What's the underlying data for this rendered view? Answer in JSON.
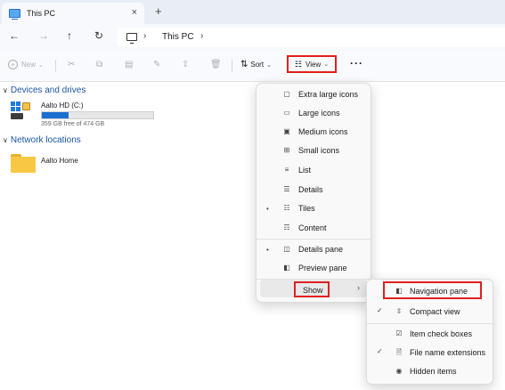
{
  "tab": {
    "title": "This PC",
    "close": "×",
    "new_tab": "+"
  },
  "nav": {
    "back": "←",
    "forward": "→",
    "up": "↑",
    "refresh": "↻"
  },
  "address": {
    "crumb": "This PC",
    "sep1": "›",
    "sep2": "›"
  },
  "toolbar": {
    "new_label": "New",
    "sort_label": "Sort",
    "view_label": "View",
    "more": "···",
    "chevron": "⌄",
    "icons": {
      "cut": "✂",
      "copy": "⧉",
      "paste": "▤",
      "rename": "✎",
      "share": "⇪",
      "delete": "🗑",
      "sort": "⇅",
      "view": "☷"
    }
  },
  "content": {
    "devices_header": "Devices and drives",
    "network_header": "Network locations",
    "drive": {
      "name": "Aalto HD (C:)",
      "free_text": "359 GB free of 474 GB",
      "used_fraction": 0.243
    },
    "network_folder": {
      "name": "Aalto Home"
    }
  },
  "view_menu": {
    "items": [
      {
        "label": "Extra large icons",
        "icon": "▢",
        "bullet": ""
      },
      {
        "label": "Large icons",
        "icon": "▭",
        "bullet": ""
      },
      {
        "label": "Medium icons",
        "icon": "▣",
        "bullet": ""
      },
      {
        "label": "Small icons",
        "icon": "⊞",
        "bullet": ""
      },
      {
        "label": "List",
        "icon": "≡",
        "bullet": ""
      },
      {
        "label": "Details",
        "icon": "☰",
        "bullet": ""
      },
      {
        "label": "Tiles",
        "icon": "☷",
        "bullet": "•"
      },
      {
        "label": "Content",
        "icon": "☶",
        "bullet": ""
      },
      {
        "label": "Details pane",
        "icon": "◫",
        "bullet": "•"
      },
      {
        "label": "Preview pane",
        "icon": "◧",
        "bullet": ""
      }
    ],
    "show_label": "Show",
    "show_arrow": "›"
  },
  "show_menu": {
    "items": [
      {
        "label": "Navigation pane",
        "icon": "◧",
        "check": ""
      },
      {
        "label": "Compact view",
        "icon": "⇳",
        "check": "✓"
      },
      {
        "label": "Item check boxes",
        "icon": "☑",
        "check": ""
      },
      {
        "label": "File name extensions",
        "icon": "🗎",
        "check": "✓"
      },
      {
        "label": "Hidden items",
        "icon": "◉",
        "check": ""
      }
    ]
  }
}
